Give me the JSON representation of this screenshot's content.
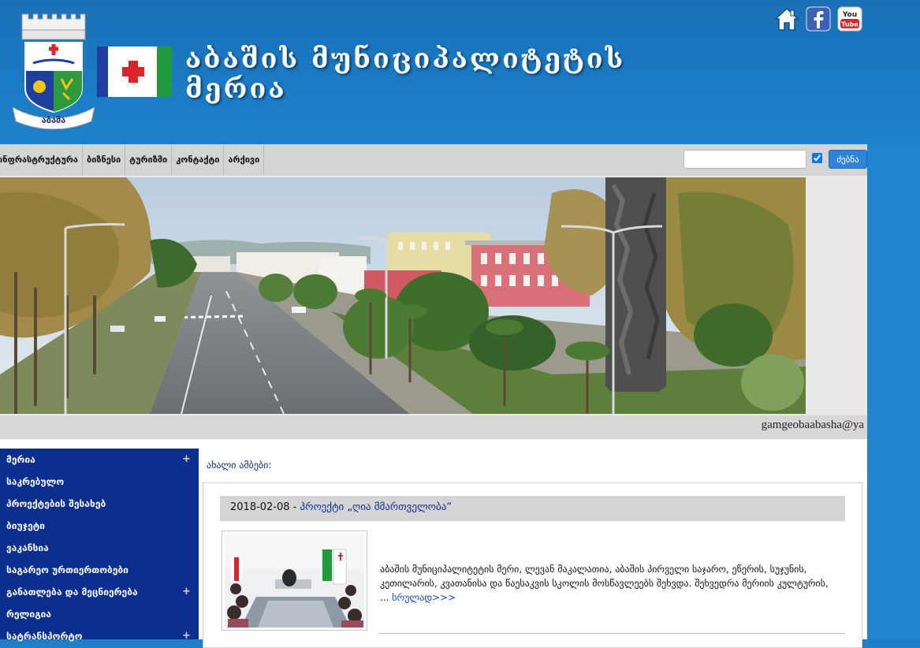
{
  "header": {
    "title_line1": "აბაშის მუნიციპალიტეტის",
    "title_line2": "მერია",
    "coat_label": "აბაშა",
    "icons": [
      "home-icon",
      "facebook-icon",
      "youtube-icon"
    ],
    "youtube_label": "You"
  },
  "nav": {
    "items": [
      "ინფრასტრუქტურა",
      "ბიზნესი",
      "ტურიზმი",
      "კონტაქტი",
      "არქივი"
    ],
    "search_value": "",
    "search_checked": true,
    "search_button": "ძებნა"
  },
  "email": "gamgeobaabasha@ya",
  "sidebar": {
    "items": [
      {
        "label": "მერია",
        "expand": "+"
      },
      {
        "label": "საკრებულო",
        "expand": ""
      },
      {
        "label": "პროექტების შესახებ",
        "expand": ""
      },
      {
        "label": "ბიუჯეტი",
        "expand": ""
      },
      {
        "label": "ვაკანსია",
        "expand": ""
      },
      {
        "label": "საგარეო ურთიერთობები",
        "expand": ""
      },
      {
        "label": "განათლება და მეცნიერება",
        "expand": "+"
      },
      {
        "label": "რელიგია",
        "expand": ""
      },
      {
        "label": "სატრანსპორტო",
        "expand": "+"
      }
    ]
  },
  "news": {
    "heading": "ახალი ამბები:",
    "items": [
      {
        "date": "2018-02-08 -",
        "title": "პროექტი „ღია მმართველობა“",
        "text": "აბაშის მუნიციპალიტეტის მერი, ლევან მაკალათია, აბაშის პირველი საჯარო, ეწერის, სუჯუნის, კეთილარის, კვათანისა და წაესაკვის სკოლის მოსწავლეებს შეხვდა. შეხვედრა მერიის კულტურის, ...",
        "more": "სრულად>>>"
      }
    ]
  },
  "colors": {
    "header_blue": "#1b7bc4",
    "nav_gray": "#d4d4d4",
    "sidebar_blue": "#0c2f8f",
    "accent_button": "#2e84d8",
    "flag_green": "#1f9a3c",
    "flag_red": "#d8262c"
  }
}
